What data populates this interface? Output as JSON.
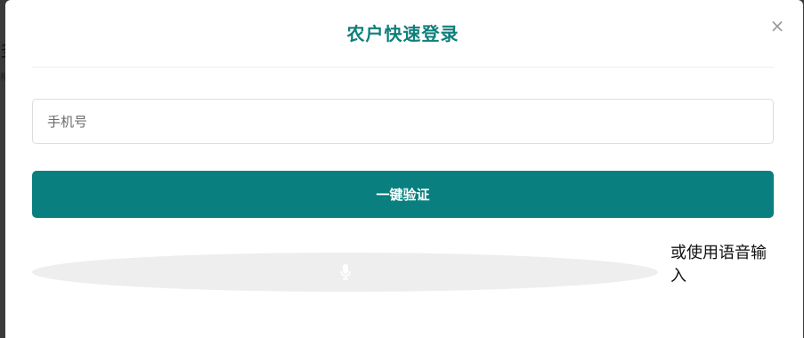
{
  "background": {
    "fragment_a": "多",
    "fragment_b": "和"
  },
  "modal": {
    "title": "农户快速登录",
    "close_glyph": "×",
    "phone_placeholder": "手机号",
    "phone_value": "",
    "verify_label": "一键验证",
    "voice_icon": "microphone-icon",
    "voice_hint": "或使用语音输入"
  },
  "colors": {
    "accent": "#0a7f7f",
    "title": "#0e7f7a",
    "voice_bg": "#eeeeee",
    "overlay": "#3a3a3a"
  }
}
